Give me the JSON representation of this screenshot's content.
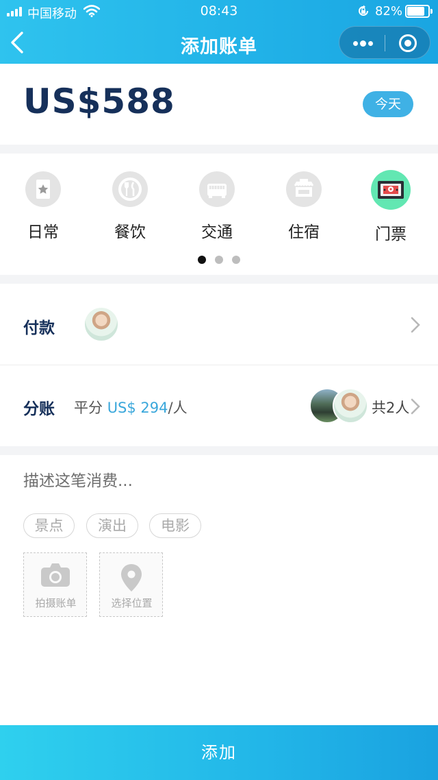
{
  "status_bar": {
    "carrier": "中国移动",
    "time": "08:43",
    "battery": "82%",
    "battery_level": 0.82
  },
  "nav": {
    "title": "添加账单"
  },
  "bill": {
    "amount": "US$588",
    "date_button": "今天"
  },
  "categories": {
    "items": [
      {
        "label": "日常",
        "icon": "daily-icon"
      },
      {
        "label": "餐饮",
        "icon": "dining-icon"
      },
      {
        "label": "交通",
        "icon": "transport-icon"
      },
      {
        "label": "住宿",
        "icon": "hotel-icon"
      },
      {
        "label": "门票",
        "icon": "ticket-icon",
        "selected": true
      }
    ],
    "page_count": 3,
    "current_page": 1
  },
  "payment": {
    "label": "付款"
  },
  "split": {
    "label": "分账",
    "mode": "平分",
    "per_person_amount": "US$ 294",
    "per_person_unit": "/人",
    "total_people": "共2人"
  },
  "description": {
    "placeholder": "描述这笔消费..."
  },
  "tags": [
    "景点",
    "演出",
    "电影"
  ],
  "uploads": {
    "photo_label": "拍摄账单",
    "location_label": "选择位置"
  },
  "submit_label": "添加",
  "colors": {
    "brand": "#22b3e8",
    "amount_text": "#16305a",
    "selected_category": "#62e7b2",
    "link_amount": "#3aa7db"
  }
}
